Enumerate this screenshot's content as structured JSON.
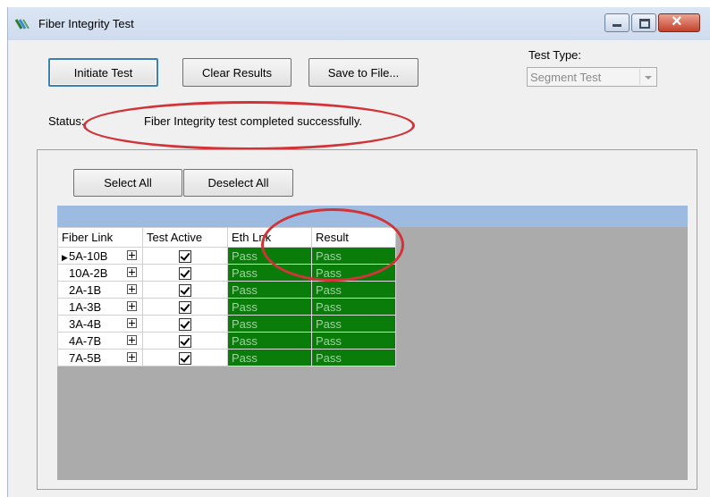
{
  "window": {
    "title": "Fiber Integrity Test"
  },
  "toolbar": {
    "initiate_label": "Initiate Test",
    "clear_label": "Clear Results",
    "save_label": "Save to File..."
  },
  "test_type": {
    "label": "Test Type:",
    "selected": "Segment Test"
  },
  "status": {
    "label": "Status:",
    "text": "Fiber Integrity test completed successfully."
  },
  "selection": {
    "select_all_label": "Select All",
    "deselect_all_label": "Deselect All"
  },
  "grid": {
    "columns": [
      "Fiber Link",
      "Test Active",
      "Eth Lnk",
      "Result"
    ],
    "rows": [
      {
        "link": "5A-10B",
        "active": true,
        "eth": "Pass",
        "result": "Pass",
        "current": true
      },
      {
        "link": "10A-2B",
        "active": true,
        "eth": "Pass",
        "result": "Pass",
        "current": false
      },
      {
        "link": "2A-1B",
        "active": true,
        "eth": "Pass",
        "result": "Pass",
        "current": false
      },
      {
        "link": "1A-3B",
        "active": true,
        "eth": "Pass",
        "result": "Pass",
        "current": false
      },
      {
        "link": "3A-4B",
        "active": true,
        "eth": "Pass",
        "result": "Pass",
        "current": false
      },
      {
        "link": "4A-7B",
        "active": true,
        "eth": "Pass",
        "result": "Pass",
        "current": false
      },
      {
        "link": "7A-5B",
        "active": true,
        "eth": "Pass",
        "result": "Pass",
        "current": false
      }
    ]
  },
  "colors": {
    "pass_background": "#0a7c0a",
    "annotation": "#d13438",
    "grid_caption": "#9dbbe0"
  }
}
